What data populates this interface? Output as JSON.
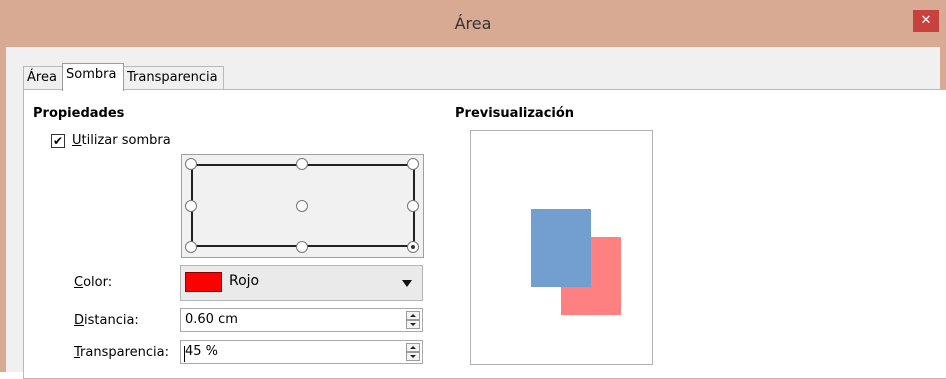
{
  "window": {
    "title": "Área",
    "close_glyph": "✕"
  },
  "tabs": [
    {
      "label": "Área"
    },
    {
      "label": "Sombra"
    },
    {
      "label": "Transparencia"
    }
  ],
  "properties": {
    "heading": "Propiedades",
    "use_shadow": {
      "label_first": "U",
      "label_rest": "tilizar sombra",
      "checked": true,
      "mark": "✔"
    },
    "position_selected": "bottom-right",
    "color": {
      "label_first": "C",
      "label_rest": "olor:",
      "value": "Rojo",
      "swatch": "#ff0000"
    },
    "distance": {
      "label_first": "D",
      "label_rest": "istancia:",
      "value": "0.60 cm"
    },
    "transparency": {
      "label_first": "T",
      "label_rest": "ransparencia:",
      "value": "45 %"
    }
  },
  "preview": {
    "heading": "Previsualización",
    "object_color": "#729fcf",
    "shadow_color": "#ff8080"
  }
}
